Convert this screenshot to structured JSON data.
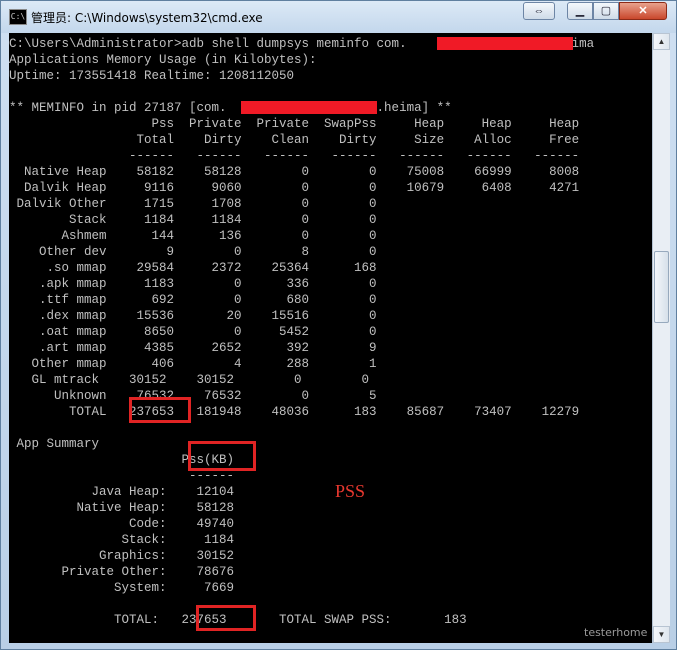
{
  "window": {
    "title": "管理员: C:\\Windows\\system32\\cmd.exe",
    "controls": {
      "restore": "⇔",
      "minimize": "▁",
      "maximize": "▢",
      "close": "✕"
    }
  },
  "console": {
    "lines": [
      "C:\\Users\\Administrator>adb shell dumpsys meminfo com.                   .heima",
      "Applications Memory Usage (in Kilobytes):",
      "Uptime: 173551418 Realtime: 1208112050",
      "",
      "** MEMINFO in pid 27187 [com.                    .heima] **",
      "                   Pss  Private  Private  SwapPss     Heap     Heap     Heap",
      "                 Total    Dirty    Clean    Dirty     Size    Alloc     Free",
      "                ------   ------   ------   ------   ------   ------   ------",
      "  Native Heap    58182    58128        0        0    75008    66999     8008",
      "  Dalvik Heap     9116     9060        0        0    10679     6408     4271",
      " Dalvik Other     1715     1708        0        0",
      "        Stack     1184     1184        0        0",
      "       Ashmem      144      136        0        0",
      "    Other dev        9        0        8        0",
      "     .so mmap    29584     2372    25364      168",
      "    .apk mmap     1183        0      336        0",
      "    .ttf mmap      692        0      680        0",
      "    .dex mmap    15536       20    15516        0",
      "    .oat mmap     8650        0     5452        0",
      "    .art mmap     4385     2652      392        9",
      "   Other mmap      406        4      288        1",
      "   GL mtrack    30152    30152        0        0",
      "      Unknown    76532    76532        0        5",
      "        TOTAL   237653   181948    48036      183    85687    73407    12279",
      "",
      " App Summary",
      "                       Pss(KB)",
      "                        ------",
      "           Java Heap:    12104",
      "         Native Heap:    58128",
      "                Code:    49740",
      "               Stack:     1184",
      "            Graphics:    30152",
      "       Private Other:    78676",
      "              System:     7669",
      "",
      "              TOTAL:   237653       TOTAL SWAP PSS:       183"
    ]
  },
  "annotation": {
    "label": "PSS"
  },
  "watermark": "testerhome",
  "colors": {
    "console_bg": "#000000",
    "console_text": "#c0c0c0",
    "redaction": "#f01a26",
    "highlight": "#e02424"
  }
}
